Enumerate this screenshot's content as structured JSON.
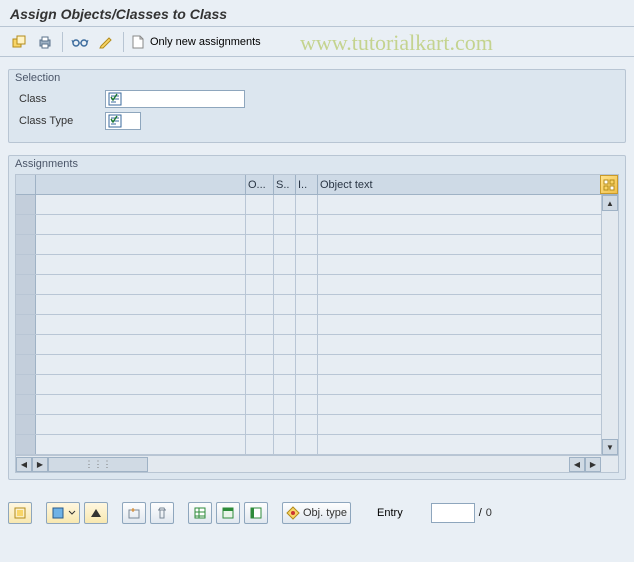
{
  "title": "Assign Objects/Classes to Class",
  "watermark": "www.tutorialkart.com",
  "toolbar": {
    "only_new_label": "Only new assignments"
  },
  "selection": {
    "legend": "Selection",
    "class_label": "Class",
    "class_value": "",
    "class_type_label": "Class Type",
    "class_type_value": ""
  },
  "assignments": {
    "legend": "Assignments",
    "col_obj": "O...",
    "col_s": "S..",
    "col_i": "I..",
    "col_txt": "Object text"
  },
  "footer": {
    "obj_type_label": "Obj. type",
    "entry_label": "Entry",
    "entry_value": "",
    "slash": "/",
    "total": "0"
  }
}
